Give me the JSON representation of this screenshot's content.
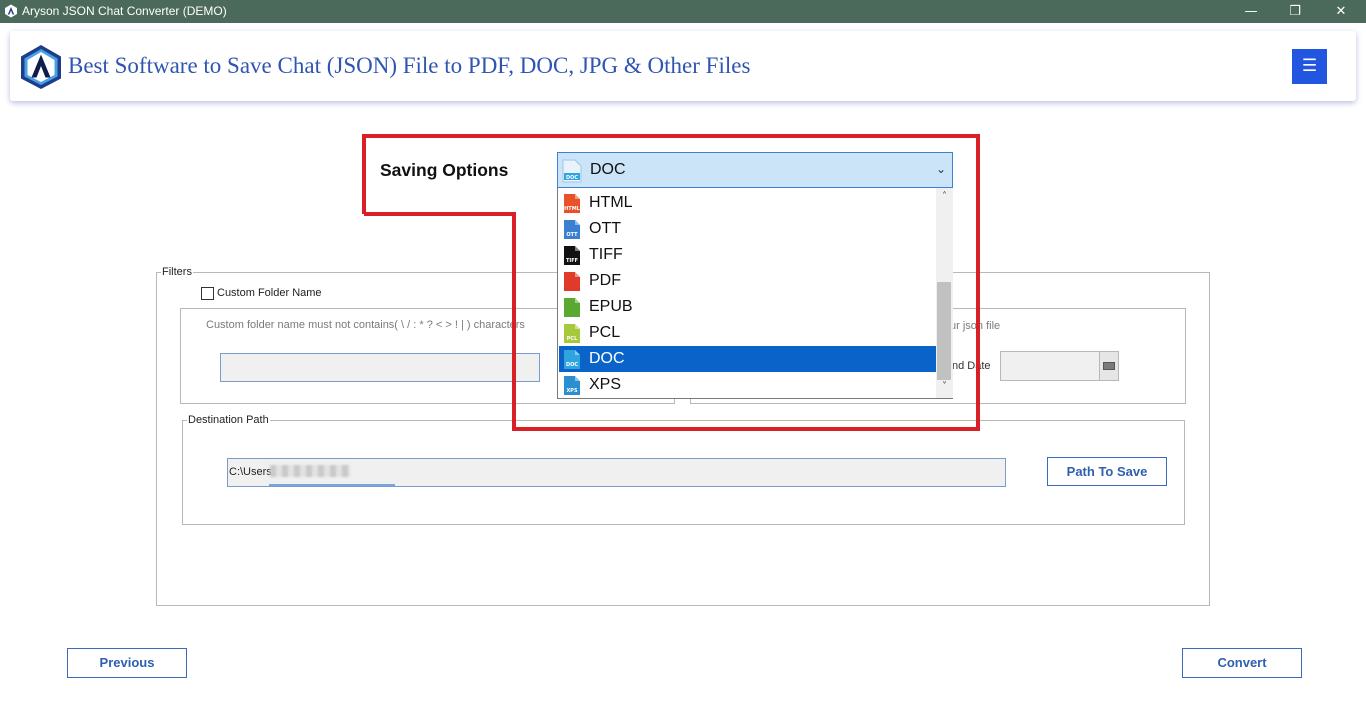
{
  "window": {
    "title": "Aryson JSON Chat Converter (DEMO)",
    "minimize": "—",
    "maximize": "❐",
    "close": "✕"
  },
  "header": {
    "headline": "Best Software to Save Chat (JSON) File to PDF, DOC, JPG & Other Files",
    "menu_icon": "☰"
  },
  "saving_options": {
    "label": "Saving Options",
    "selected": "DOC",
    "options": [
      {
        "label": "HTML",
        "icon_text": "HTML",
        "icon_color": "#e8512a"
      },
      {
        "label": "OTT",
        "icon_text": "OTT",
        "icon_color": "#3a7fd0"
      },
      {
        "label": "TIFF",
        "icon_text": "TIFF",
        "icon_color": "#111111"
      },
      {
        "label": "PDF",
        "icon_text": "",
        "icon_color": "#e03a2a"
      },
      {
        "label": "EPUB",
        "icon_text": "",
        "icon_color": "#5aa832"
      },
      {
        "label": "PCL",
        "icon_text": "PCL",
        "icon_color": "#a6c93a"
      },
      {
        "label": "DOC",
        "icon_text": "DOC",
        "icon_color": "#2fa5e0"
      },
      {
        "label": "XPS",
        "icon_text": "XPS",
        "icon_color": "#2a8fd0"
      }
    ],
    "selected_index": 6,
    "annotation_color": "#d92027"
  },
  "filters": {
    "legend": "Filters",
    "custom_folder_label": "Custom Folder Name",
    "custom_folder_hint": "Custom folder name must not contains( \\ / : * ? < > ! | ) characters",
    "date_hint_fragment": "ur json file",
    "end_date_label": "nd Date"
  },
  "destination": {
    "legend": "Destination Path",
    "path": "C:\\Users",
    "path_button": "Path To Save"
  },
  "footer": {
    "previous": "Previous",
    "convert": "Convert"
  },
  "colors": {
    "accent": "#2255e0",
    "button_text": "#2e5fb0",
    "titlebar": "#4b6a5c"
  }
}
